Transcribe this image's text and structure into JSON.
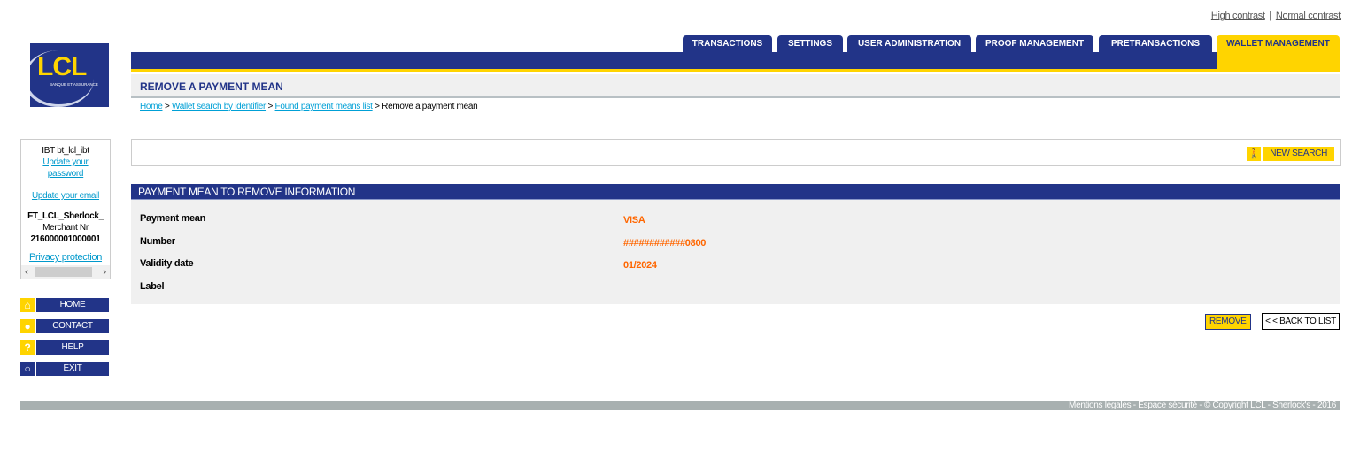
{
  "contrast": {
    "high": "High contrast",
    "separator": "|",
    "normal": "Normal contrast"
  },
  "logo": {
    "name": "LCL",
    "tagline": "BANQUE ET ASSURANCE"
  },
  "tabs": [
    {
      "label": "TRANSACTIONS",
      "active": false
    },
    {
      "label": "SETTINGS",
      "active": false
    },
    {
      "label": "USER ADMINISTRATION",
      "active": false
    },
    {
      "label": "PROOF MANAGEMENT",
      "active": false
    },
    {
      "label": "PRETRANSACTIONS",
      "active": false
    },
    {
      "label": "WALLET MANAGEMENT",
      "active": true
    }
  ],
  "page": {
    "title": "REMOVE A PAYMENT MEAN"
  },
  "breadcrumb": {
    "items": [
      "Home",
      "Wallet search by identifier",
      "Found payment means list"
    ],
    "separator": ">",
    "current": "Remove a payment mean"
  },
  "user": {
    "name": "IBT bt_lcl_ibt",
    "update_password": "Update your password",
    "update_email": "Update your email",
    "merchant_name": "FT_LCL_Sherlock_",
    "merchant_label": "Merchant Nr",
    "merchant_nr": "216000001000001",
    "privacy": "Privacy protection"
  },
  "sidenav": [
    {
      "label": "HOME",
      "icon": "home-icon",
      "glyph": "⌂"
    },
    {
      "label": "CONTACT",
      "icon": "speech-bubble-icon",
      "glyph": "●"
    },
    {
      "label": "HELP",
      "icon": "question-icon",
      "glyph": "?"
    },
    {
      "label": "EXIT",
      "icon": "power-icon",
      "glyph": "○"
    }
  ],
  "search": {
    "new_search_label": "NEW SEARCH",
    "icon_glyph": "🚶"
  },
  "info": {
    "header": "PAYMENT MEAN TO REMOVE INFORMATION",
    "rows": [
      {
        "label": "Payment mean",
        "value": "VISA"
      },
      {
        "label": "Number",
        "value": "############0800"
      },
      {
        "label": "Validity date",
        "value": "01/2024"
      },
      {
        "label": "Label",
        "value": ""
      }
    ]
  },
  "actions": {
    "remove": "REMOVE",
    "back": "< < BACK TO LIST"
  },
  "footer": {
    "legal": "Mentions légales",
    "security": "Espace sécurité",
    "copyright": "© Copyright LCL - Sherlock's - 2016",
    "separator": " - "
  },
  "colors": {
    "brand_blue": "#223488",
    "brand_yellow": "#ffd400",
    "value_orange": "#ff6600",
    "link": "#00a0d6"
  }
}
